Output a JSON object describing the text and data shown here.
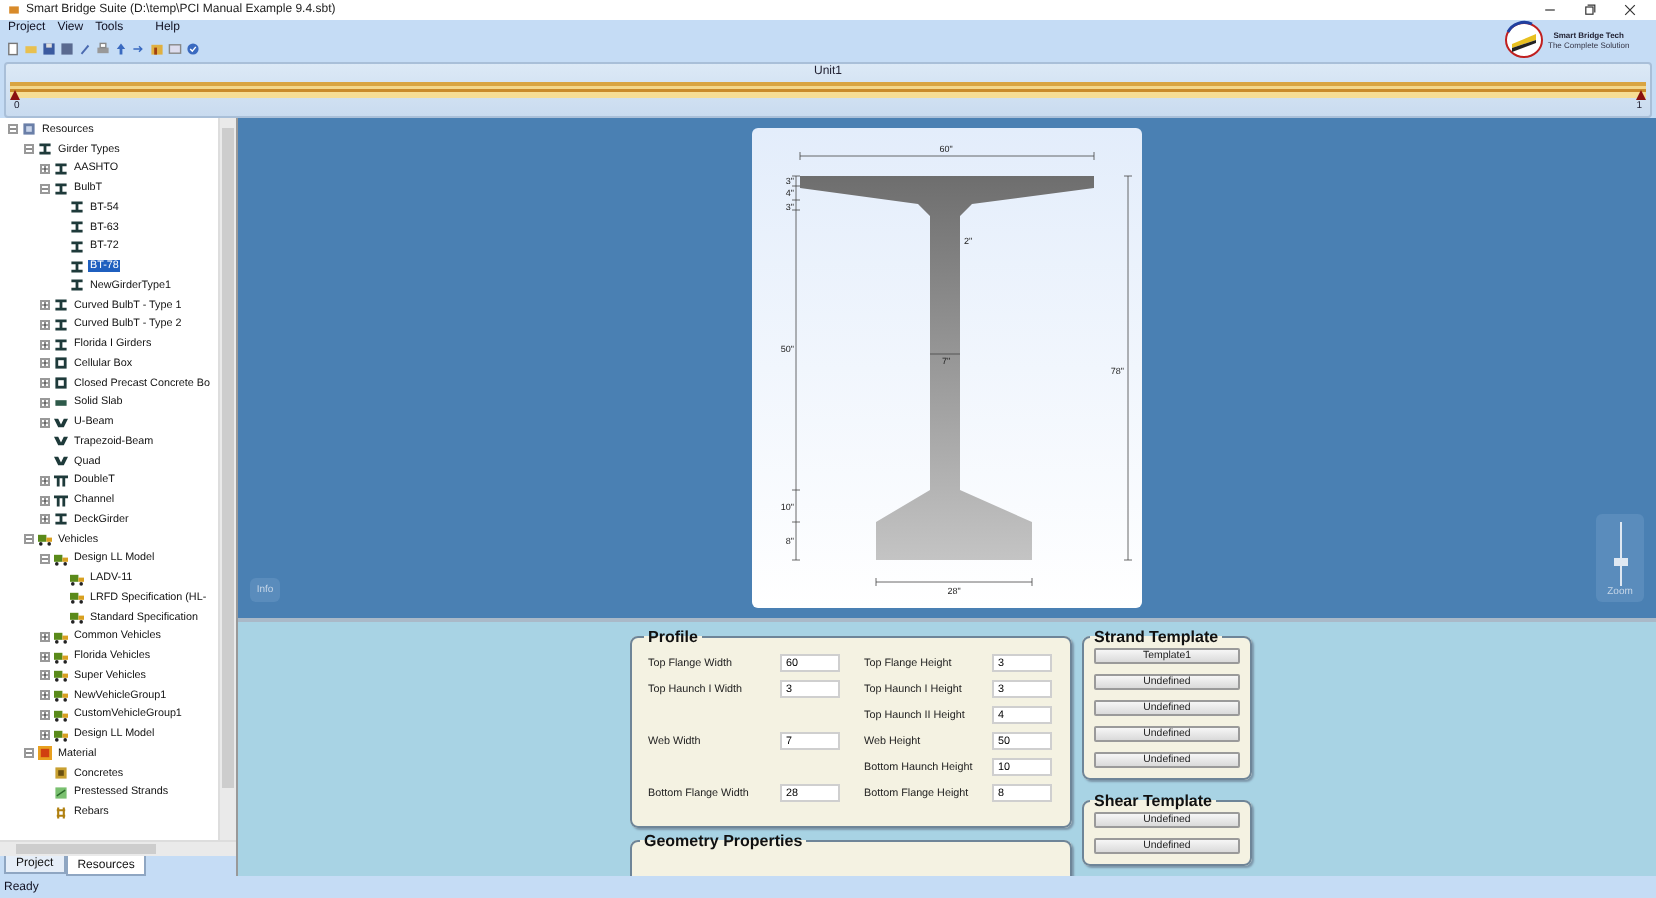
{
  "window": {
    "title": "Smart Bridge Suite (D:\\temp\\PCI Manual Example 9.4.sbt)"
  },
  "menu": [
    "Project",
    "View",
    "Tools",
    "Help"
  ],
  "logo": {
    "name": "Smart Bridge Tech",
    "tagline": "The Complete Solution"
  },
  "unit_bar": {
    "title": "Unit1",
    "start_label": "0",
    "end_label": "1"
  },
  "tree": [
    {
      "label": "Resources",
      "kind": "resources",
      "expanded": true,
      "selected": false,
      "children": [
        {
          "label": "Girder Types",
          "kind": "girder",
          "expanded": true,
          "selected": false,
          "children": [
            {
              "label": "AASHTO",
              "kind": "girder",
              "expanded": false,
              "selected": false
            },
            {
              "label": "BulbT",
              "kind": "girder",
              "expanded": true,
              "selected": false,
              "children": [
                {
                  "label": "BT-54",
                  "kind": "girder",
                  "selected": false
                },
                {
                  "label": "BT-63",
                  "kind": "girder",
                  "selected": false
                },
                {
                  "label": "BT-72",
                  "kind": "girder",
                  "selected": false
                },
                {
                  "label": "BT-78",
                  "kind": "girder",
                  "selected": true
                },
                {
                  "label": "NewGirderType1",
                  "kind": "girder",
                  "selected": false
                }
              ]
            },
            {
              "label": "Curved BulbT - Type 1",
              "kind": "girder",
              "expanded": false,
              "selected": false
            },
            {
              "label": "Curved BulbT - Type 2",
              "kind": "girder",
              "expanded": false,
              "selected": false
            },
            {
              "label": "Florida I Girders",
              "kind": "girder",
              "expanded": false,
              "selected": false
            },
            {
              "label": "Cellular Box",
              "kind": "box",
              "expanded": false,
              "selected": false
            },
            {
              "label": "Closed Precast Concrete Bo",
              "kind": "box",
              "expanded": false,
              "selected": false
            },
            {
              "label": "Solid Slab",
              "kind": "slab",
              "expanded": false,
              "selected": false
            },
            {
              "label": "U-Beam",
              "kind": "ubeam",
              "expanded": false,
              "selected": false
            },
            {
              "label": "Trapezoid-Beam",
              "kind": "ubeam",
              "selected": false
            },
            {
              "label": "Quad",
              "kind": "ubeam",
              "selected": false
            },
            {
              "label": "DoubleT",
              "kind": "doublet",
              "expanded": false,
              "selected": false
            },
            {
              "label": "Channel",
              "kind": "doublet",
              "expanded": false,
              "selected": false
            },
            {
              "label": "DeckGirder",
              "kind": "girder",
              "expanded": false,
              "selected": false
            }
          ]
        },
        {
          "label": "Vehicles",
          "kind": "vehicle",
          "expanded": true,
          "selected": false,
          "children": [
            {
              "label": "Design LL Model",
              "kind": "vehicle",
              "expanded": true,
              "selected": false,
              "children": [
                {
                  "label": "LADV-11",
                  "kind": "vehicle",
                  "selected": false
                },
                {
                  "label": "LRFD Specification (HL-",
                  "kind": "vehicle",
                  "selected": false
                },
                {
                  "label": "Standard Specification",
                  "kind": "vehicle",
                  "selected": false
                }
              ]
            },
            {
              "label": "Common Vehicles",
              "kind": "vehicle",
              "expanded": false,
              "selected": false
            },
            {
              "label": "Florida Vehicles",
              "kind": "vehicle",
              "expanded": false,
              "selected": false
            },
            {
              "label": "Super Vehicles",
              "kind": "vehicle",
              "expanded": false,
              "selected": false
            },
            {
              "label": "NewVehicleGroup1",
              "kind": "vehicle",
              "expanded": false,
              "selected": false
            },
            {
              "label": "CustomVehicleGroup1",
              "kind": "vehicle",
              "expanded": false,
              "selected": false
            },
            {
              "label": "Design LL Model",
              "kind": "vehicle",
              "expanded": false,
              "selected": false
            }
          ]
        },
        {
          "label": "Material",
          "kind": "material",
          "expanded": true,
          "selected": false,
          "children": [
            {
              "label": "Concretes",
              "kind": "concrete",
              "selected": false
            },
            {
              "label": "Prestessed Strands",
              "kind": "strand",
              "selected": false
            },
            {
              "label": "Rebars",
              "kind": "rebar",
              "selected": false
            }
          ]
        }
      ]
    }
  ],
  "left_tabs": [
    {
      "label": "Project",
      "selected": false
    },
    {
      "label": "Resources",
      "selected": true
    }
  ],
  "section": {
    "dimensions": {
      "top_width": "60\"",
      "flange_height": "3\"",
      "haunch1_height": "4\"",
      "haunch2_height": "3\"",
      "haunch_width": "2\"",
      "web_height": "50\"",
      "web_width": "7\"",
      "bottom_haunch_height": "10\"",
      "bottom_flange_height": "8\"",
      "total_height": "78\"",
      "bottom_width": "28\""
    }
  },
  "info_button": "Info",
  "zoom": {
    "label": "Zoom",
    "level": 0.3
  },
  "profile": {
    "title": "Profile",
    "rows": [
      {
        "left": {
          "label": "Top Flange Width",
          "value": "60"
        },
        "right": {
          "label": "Top Flange Height",
          "value": "3"
        }
      },
      {
        "left": {
          "label": "Top Haunch I Width",
          "value": "3"
        },
        "right": {
          "label": "Top Haunch I Height",
          "value": "3"
        }
      },
      {
        "right": {
          "label": "Top Haunch II Height",
          "value": "4"
        }
      },
      {
        "left": {
          "label": "Web Width",
          "value": "7"
        },
        "right": {
          "label": "Web Height",
          "value": "50"
        }
      },
      {
        "right": {
          "label": "Bottom Haunch Height",
          "value": "10"
        }
      },
      {
        "left": {
          "label": "Bottom Flange Width",
          "value": "28"
        },
        "right": {
          "label": "Bottom Flange Height",
          "value": "8"
        }
      }
    ]
  },
  "geometry": {
    "title": "Geometry Properties"
  },
  "strand_template": {
    "title": "Strand Template",
    "buttons": [
      "Template1",
      "Undefined",
      "Undefined",
      "Undefined",
      "Undefined"
    ]
  },
  "shear_template": {
    "title": "Shear Template",
    "buttons": [
      "Undefined",
      "Undefined"
    ]
  },
  "status_bar": "Ready"
}
